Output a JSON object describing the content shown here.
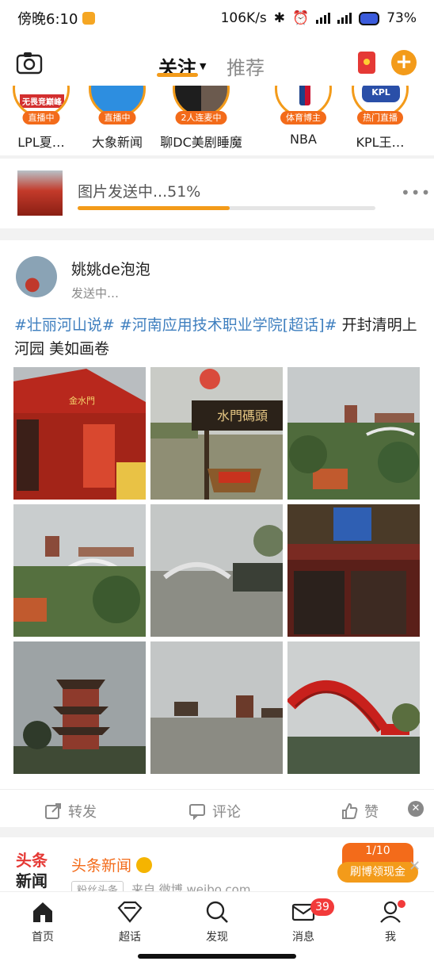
{
  "status_bar": {
    "time": "傍晚6:10",
    "speed": "106K/s",
    "battery": "73%"
  },
  "top_nav": {
    "follow_tab": "关注",
    "recommend_tab": "推荐"
  },
  "stories": [
    {
      "name": "LPL夏…",
      "badge": "直播中",
      "logo": "无畏竞巅峰"
    },
    {
      "name": "大象新闻",
      "badge": "直播中"
    },
    {
      "name": "聊DC美剧睡魔",
      "badge": "2人连麦中"
    },
    {
      "name": "NBA",
      "badge": "体育博主"
    },
    {
      "name": "KPL王…",
      "badge": "热门直播"
    }
  ],
  "upload": {
    "text": "图片发送中...51%",
    "progress": 0.51
  },
  "post": {
    "username": "姚姚de泡泡",
    "status": "发送中…",
    "tag1": "#壮丽河山说#",
    "tag2": "#河南应用技术职业学院[超话]#",
    "text_rest": " 开封清明上河园 美如画卷",
    "sign_vertical": "金水門",
    "sign_wooden": "水門碼頭"
  },
  "actions": {
    "repost": "转发",
    "comment": "评论",
    "like": "赞"
  },
  "next_card": {
    "name": "头条新闻",
    "fans_tag": "粉丝头条",
    "source": "来自 微博 weibo.com",
    "logo_text": "头条新闻",
    "promo_fraction": "1/10",
    "promo_label": "刷博领现金"
  },
  "bottom_nav": {
    "home": "首页",
    "topic": "超话",
    "discover": "发现",
    "message": "消息",
    "me": "我",
    "message_count": "39"
  },
  "colors": {
    "accent": "#f39b1a",
    "link": "#3f7fbf",
    "badge": "#f23a3a"
  }
}
